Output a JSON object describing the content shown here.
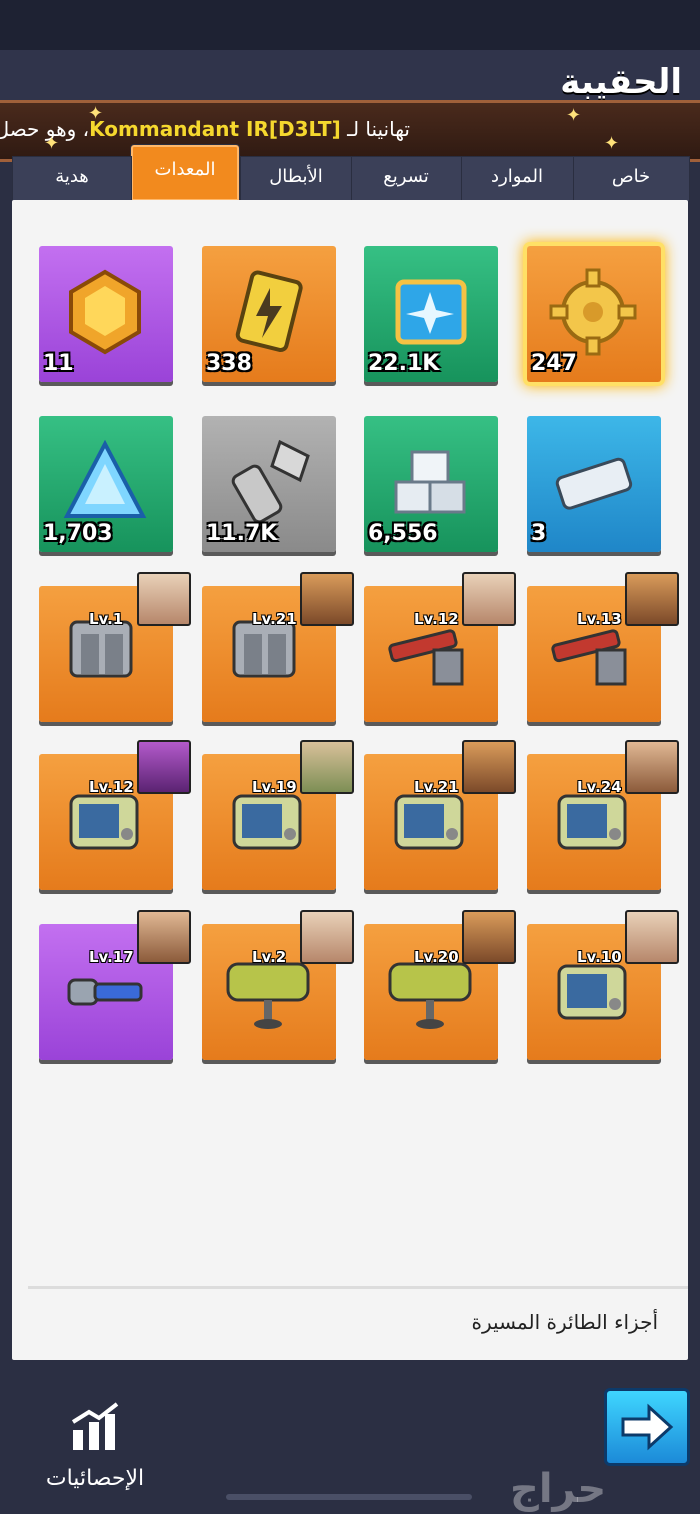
{
  "header": {
    "title": "الحقيبة"
  },
  "banner": {
    "prefix": "تهانينا لـ",
    "name": "Kommandant IR[D3LT]",
    "suffix": "، وهو حصل"
  },
  "tabs": [
    {
      "label": "خاص"
    },
    {
      "label": "الموارد"
    },
    {
      "label": "تسريع"
    },
    {
      "label": "الأبطال"
    },
    {
      "label": "المعدات"
    },
    {
      "label": "هدية"
    }
  ],
  "active_tab": "المعدات",
  "resources": [
    {
      "icon": "honeycomb-crystal-icon",
      "qty": "11",
      "color": "purple"
    },
    {
      "icon": "lightning-battery-icon",
      "qty": "338",
      "color": "orange"
    },
    {
      "icon": "blueprint-plane-icon",
      "qty": "22.1K",
      "color": "green"
    },
    {
      "icon": "gear-icon",
      "qty": "247",
      "color": "orange"
    },
    {
      "icon": "blue-crystal-icon",
      "qty": "1,703",
      "color": "green"
    },
    {
      "icon": "bolt-screw-icon",
      "qty": "11.7K",
      "color": "gray"
    },
    {
      "icon": "silver-ingot-stack-icon",
      "qty": "6,556",
      "color": "green"
    },
    {
      "icon": "titanium-ingot-icon",
      "qty": "3",
      "color": "blue"
    }
  ],
  "equipment": [
    {
      "icon": "armor-plate-icon",
      "level": "Lv.1",
      "color": "orange"
    },
    {
      "icon": "armor-plate-icon",
      "level": "Lv.21",
      "color": "orange"
    },
    {
      "icon": "cannon-turret-icon",
      "level": "Lv.12",
      "color": "orange"
    },
    {
      "icon": "cannon-turret-icon",
      "level": "Lv.13",
      "color": "orange"
    },
    {
      "icon": "radar-panel-icon",
      "level": "Lv.12",
      "color": "orange"
    },
    {
      "icon": "radar-panel-icon",
      "level": "Lv.19",
      "color": "orange"
    },
    {
      "icon": "radar-panel-icon",
      "level": "Lv.21",
      "color": "orange"
    },
    {
      "icon": "radar-panel-icon",
      "level": "Lv.24",
      "color": "orange"
    },
    {
      "icon": "flashlight-icon",
      "level": "Lv.17",
      "color": "purple"
    },
    {
      "icon": "wing-plate-icon",
      "level": "Lv.2",
      "color": "orange"
    },
    {
      "icon": "wing-plate-icon",
      "level": "Lv.20",
      "color": "orange"
    },
    {
      "icon": "radar-panel-icon",
      "level": "Lv.10",
      "color": "orange"
    }
  ],
  "selected_item_description": "أجزاء الطائرة المسيرة",
  "footer": {
    "stats_label": "الإحصائيات",
    "watermark": "حراج"
  }
}
